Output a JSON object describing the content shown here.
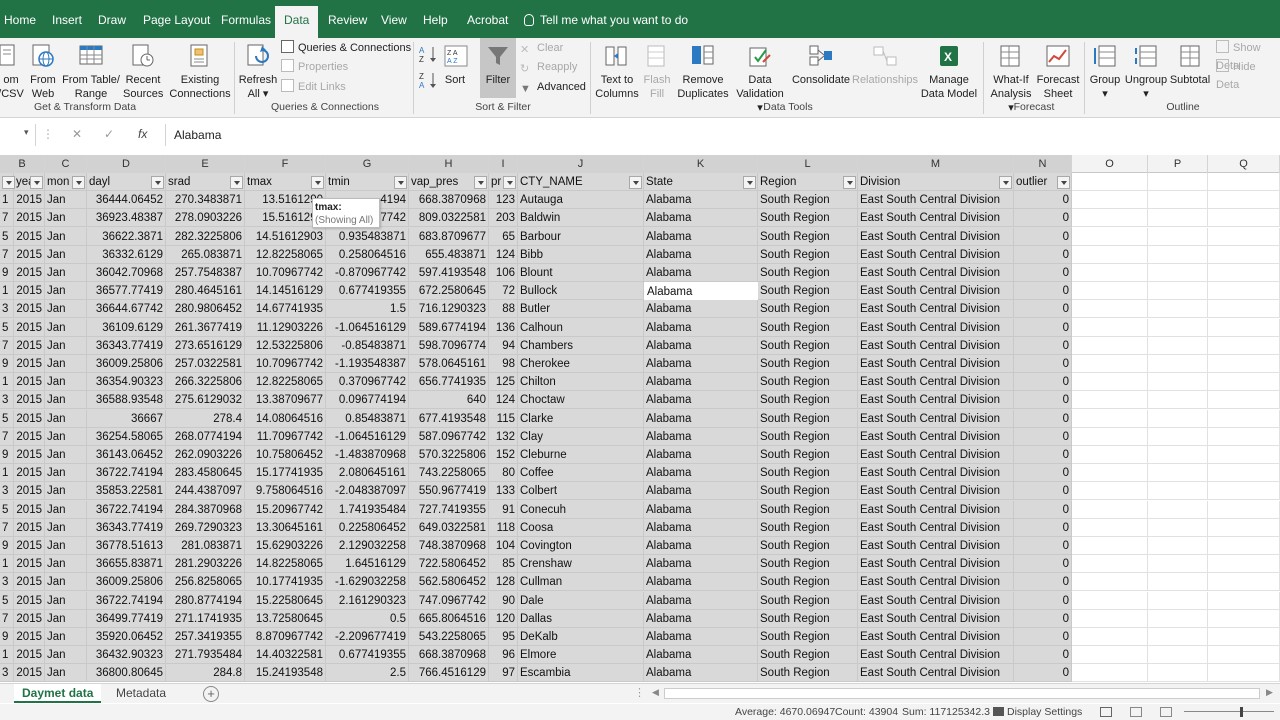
{
  "menu_tabs": [
    "Home",
    "Insert",
    "Draw",
    "Page Layout",
    "Formulas",
    "Data",
    "Review",
    "View",
    "Help",
    "Acrobat"
  ],
  "active_tab": "Data",
  "tell_me": "Tell me what you want to do",
  "ribbon": {
    "get_transform": {
      "from_csv_top": "om",
      "from_csv_bottom": "/CSV",
      "from_web_top": "From",
      "from_web_bottom": "Web",
      "from_table_top": "From Table/",
      "from_table_bottom": "Range",
      "recent_top": "Recent",
      "recent_bottom": "Sources",
      "existing_top": "Existing",
      "existing_bottom": "Connections",
      "label": "Get & Transform Data"
    },
    "queries": {
      "refresh_top": "Refresh",
      "refresh_bottom": "All",
      "queries_connections": "Queries & Connections",
      "properties": "Properties",
      "edit_links": "Edit Links",
      "label": "Queries & Connections"
    },
    "sort_filter": {
      "sort": "Sort",
      "filter": "Filter",
      "clear": "Clear",
      "reapply": "Reapply",
      "advanced": "Advanced",
      "label": "Sort & Filter"
    },
    "data_tools": {
      "text_to_columns_top": "Text to",
      "text_to_columns_bottom": "Columns",
      "flash_fill_top": "Flash",
      "flash_fill_bottom": "Fill",
      "remove_dup_top": "Remove",
      "remove_dup_bottom": "Duplicates",
      "validation_top": "Data",
      "validation_bottom": "Validation",
      "consolidate": "Consolidate",
      "relationships": "Relationships",
      "manage_model_top": "Manage",
      "manage_model_bottom": "Data Model",
      "label": "Data Tools"
    },
    "forecast": {
      "whatif_top": "What-If",
      "whatif_bottom": "Analysis",
      "forecast_top": "Forecast",
      "forecast_bottom": "Sheet",
      "label": "Forecast"
    },
    "outline": {
      "group": "Group",
      "ungroup": "Ungroup",
      "subtotal": "Subtotal",
      "show_detail": "Show Deta",
      "hide_detail": "Hide Deta",
      "label": "Outline"
    }
  },
  "formula_bar": {
    "fx": "fx",
    "value": "Alabama"
  },
  "col_letters": [
    "B",
    "C",
    "D",
    "E",
    "F",
    "G",
    "H",
    "I",
    "J",
    "K",
    "L",
    "M",
    "N",
    "O",
    "P",
    "Q"
  ],
  "table_headers": [
    "yea",
    "mon",
    "dayl",
    "srad",
    "tmax",
    "tmin",
    "vap_pres",
    "pr",
    "CTY_NAME",
    "State",
    "Region",
    "Division",
    "outlier"
  ],
  "tooltip": {
    "line1": "tmax:",
    "line2": "(Showing All)"
  },
  "rows": [
    [
      "1",
      "2015",
      "Jan",
      "36444.06452",
      "270.3483871",
      "13.5161290",
      "4194",
      "668.3870968",
      "123",
      "Autauga",
      "Alabama",
      "South Region",
      "East South Central Division",
      "0"
    ],
    [
      "7",
      "2015",
      "Jan",
      "36923.48387",
      "278.0903226",
      "15.5161290",
      "7742",
      "809.0322581",
      "203",
      "Baldwin",
      "Alabama",
      "South Region",
      "East South Central Division",
      "0"
    ],
    [
      "5",
      "2015",
      "Jan",
      "36622.3871",
      "282.3225806",
      "14.51612903",
      "0.935483871",
      "683.8709677",
      "65",
      "Barbour",
      "Alabama",
      "South Region",
      "East South Central Division",
      "0"
    ],
    [
      "7",
      "2015",
      "Jan",
      "36332.6129",
      "265.083871",
      "12.82258065",
      "0.258064516",
      "655.483871",
      "124",
      "Bibb",
      "Alabama",
      "South Region",
      "East South Central Division",
      "0"
    ],
    [
      "9",
      "2015",
      "Jan",
      "36042.70968",
      "257.7548387",
      "10.70967742",
      "-0.870967742",
      "597.4193548",
      "106",
      "Blount",
      "Alabama",
      "South Region",
      "East South Central Division",
      "0"
    ],
    [
      "1",
      "2015",
      "Jan",
      "36577.77419",
      "280.4645161",
      "14.14516129",
      "0.677419355",
      "672.2580645",
      "72",
      "Bullock",
      "Alabama",
      "South Region",
      "East South Central Division",
      "0"
    ],
    [
      "3",
      "2015",
      "Jan",
      "36644.67742",
      "280.9806452",
      "14.67741935",
      "1.5",
      "716.1290323",
      "88",
      "Butler",
      "Alabama",
      "South Region",
      "East South Central Division",
      "0"
    ],
    [
      "5",
      "2015",
      "Jan",
      "36109.6129",
      "261.3677419",
      "11.12903226",
      "-1.064516129",
      "589.6774194",
      "136",
      "Calhoun",
      "Alabama",
      "South Region",
      "East South Central Division",
      "0"
    ],
    [
      "7",
      "2015",
      "Jan",
      "36343.77419",
      "273.6516129",
      "12.53225806",
      "-0.85483871",
      "598.7096774",
      "94",
      "Chambers",
      "Alabama",
      "South Region",
      "East South Central Division",
      "0"
    ],
    [
      "9",
      "2015",
      "Jan",
      "36009.25806",
      "257.0322581",
      "10.70967742",
      "-1.193548387",
      "578.0645161",
      "98",
      "Cherokee",
      "Alabama",
      "South Region",
      "East South Central Division",
      "0"
    ],
    [
      "1",
      "2015",
      "Jan",
      "36354.90323",
      "266.3225806",
      "12.82258065",
      "0.370967742",
      "656.7741935",
      "125",
      "Chilton",
      "Alabama",
      "South Region",
      "East South Central Division",
      "0"
    ],
    [
      "3",
      "2015",
      "Jan",
      "36588.93548",
      "275.6129032",
      "13.38709677",
      "0.096774194",
      "640",
      "124",
      "Choctaw",
      "Alabama",
      "South Region",
      "East South Central Division",
      "0"
    ],
    [
      "5",
      "2015",
      "Jan",
      "36667",
      "278.4",
      "14.08064516",
      "0.85483871",
      "677.4193548",
      "115",
      "Clarke",
      "Alabama",
      "South Region",
      "East South Central Division",
      "0"
    ],
    [
      "7",
      "2015",
      "Jan",
      "36254.58065",
      "268.0774194",
      "11.70967742",
      "-1.064516129",
      "587.0967742",
      "132",
      "Clay",
      "Alabama",
      "South Region",
      "East South Central Division",
      "0"
    ],
    [
      "9",
      "2015",
      "Jan",
      "36143.06452",
      "262.0903226",
      "10.75806452",
      "-1.483870968",
      "570.3225806",
      "152",
      "Cleburne",
      "Alabama",
      "South Region",
      "East South Central Division",
      "0"
    ],
    [
      "1",
      "2015",
      "Jan",
      "36722.74194",
      "283.4580645",
      "15.17741935",
      "2.080645161",
      "743.2258065",
      "80",
      "Coffee",
      "Alabama",
      "South Region",
      "East South Central Division",
      "0"
    ],
    [
      "3",
      "2015",
      "Jan",
      "35853.22581",
      "244.4387097",
      "9.758064516",
      "-2.048387097",
      "550.9677419",
      "133",
      "Colbert",
      "Alabama",
      "South Region",
      "East South Central Division",
      "0"
    ],
    [
      "5",
      "2015",
      "Jan",
      "36722.74194",
      "284.3870968",
      "15.20967742",
      "1.741935484",
      "727.7419355",
      "91",
      "Conecuh",
      "Alabama",
      "South Region",
      "East South Central Division",
      "0"
    ],
    [
      "7",
      "2015",
      "Jan",
      "36343.77419",
      "269.7290323",
      "13.30645161",
      "0.225806452",
      "649.0322581",
      "118",
      "Coosa",
      "Alabama",
      "South Region",
      "East South Central Division",
      "0"
    ],
    [
      "9",
      "2015",
      "Jan",
      "36778.51613",
      "281.083871",
      "15.62903226",
      "2.129032258",
      "748.3870968",
      "104",
      "Covington",
      "Alabama",
      "South Region",
      "East South Central Division",
      "0"
    ],
    [
      "1",
      "2015",
      "Jan",
      "36655.83871",
      "281.2903226",
      "14.82258065",
      "1.64516129",
      "722.5806452",
      "85",
      "Crenshaw",
      "Alabama",
      "South Region",
      "East South Central Division",
      "0"
    ],
    [
      "3",
      "2015",
      "Jan",
      "36009.25806",
      "256.8258065",
      "10.17741935",
      "-1.629032258",
      "562.5806452",
      "128",
      "Cullman",
      "Alabama",
      "South Region",
      "East South Central Division",
      "0"
    ],
    [
      "5",
      "2015",
      "Jan",
      "36722.74194",
      "280.8774194",
      "15.22580645",
      "2.161290323",
      "747.0967742",
      "90",
      "Dale",
      "Alabama",
      "South Region",
      "East South Central Division",
      "0"
    ],
    [
      "7",
      "2015",
      "Jan",
      "36499.77419",
      "271.1741935",
      "13.72580645",
      "0.5",
      "665.8064516",
      "120",
      "Dallas",
      "Alabama",
      "South Region",
      "East South Central Division",
      "0"
    ],
    [
      "9",
      "2015",
      "Jan",
      "35920.06452",
      "257.3419355",
      "8.870967742",
      "-2.209677419",
      "543.2258065",
      "95",
      "DeKalb",
      "Alabama",
      "South Region",
      "East South Central Division",
      "0"
    ],
    [
      "1",
      "2015",
      "Jan",
      "36432.90323",
      "271.7935484",
      "14.40322581",
      "0.677419355",
      "668.3870968",
      "96",
      "Elmore",
      "Alabama",
      "South Region",
      "East South Central Division",
      "0"
    ],
    [
      "3",
      "2015",
      "Jan",
      "36800.80645",
      "284.8",
      "15.24193548",
      "2.5",
      "766.4516129",
      "97",
      "Escambia",
      "Alabama",
      "South Region",
      "East South Central Division",
      "0"
    ]
  ],
  "sheet_tabs": [
    "Daymet data",
    "Metadata"
  ],
  "active_sheet": "Daymet data",
  "status": {
    "average": "Average: 4670.06947",
    "count": "Count: 43904",
    "sum": "Sum: 117125342.3",
    "display_settings": "Display Settings"
  }
}
